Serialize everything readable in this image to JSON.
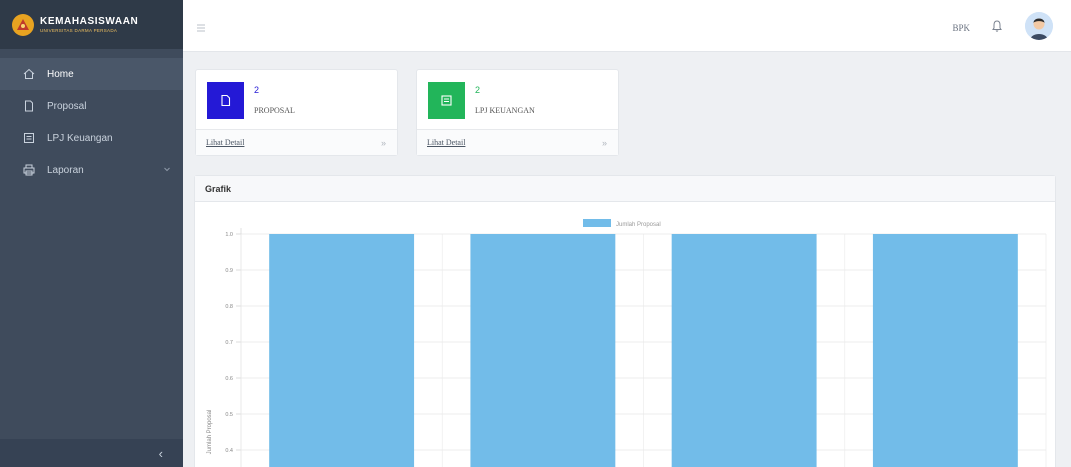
{
  "brand": {
    "title": "KEMAHASISWAAN",
    "subtitle": "UNIVERSITAS DARMA PERSADA"
  },
  "sidebar": {
    "items": [
      {
        "label": "Home",
        "icon": "home-icon",
        "active": true
      },
      {
        "label": "Proposal",
        "icon": "document-icon",
        "active": false
      },
      {
        "label": "LPJ Keuangan",
        "icon": "book-icon",
        "active": false
      },
      {
        "label": "Laporan",
        "icon": "printer-icon",
        "active": false,
        "has_submenu": true
      }
    ],
    "collapse_label": "‹"
  },
  "topbar": {
    "menu_icon": "hamburger-icon",
    "user_name": "BPK",
    "bell_icon": "bell-icon",
    "avatar_icon": "avatar-icon"
  },
  "cards": [
    {
      "count": "2",
      "label": "PROPOSAL",
      "link": "Lihat Detail",
      "arrow": "»",
      "color": "#2419d6",
      "icon": "document-icon"
    },
    {
      "count": "2",
      "label": "LPJ KEUANGAN",
      "link": "Lihat Detail",
      "arrow": "»",
      "color": "#22b55a",
      "icon": "book-icon"
    }
  ],
  "panel": {
    "title": "Grafik"
  },
  "chart_data": {
    "type": "bar",
    "categories": [
      "",
      "",
      "",
      ""
    ],
    "series": [
      {
        "name": "Jumlah Proposal",
        "values": [
          1,
          1,
          1,
          1
        ],
        "color": "#72bce9"
      }
    ],
    "ylabel": "Jumlah Proposal",
    "yticks": [
      "1.0",
      "0.9",
      "0.8",
      "0.7",
      "0.6",
      "0.5",
      "0.4"
    ],
    "ylim": [
      0,
      1
    ],
    "grid": true,
    "legend": "top-center"
  }
}
